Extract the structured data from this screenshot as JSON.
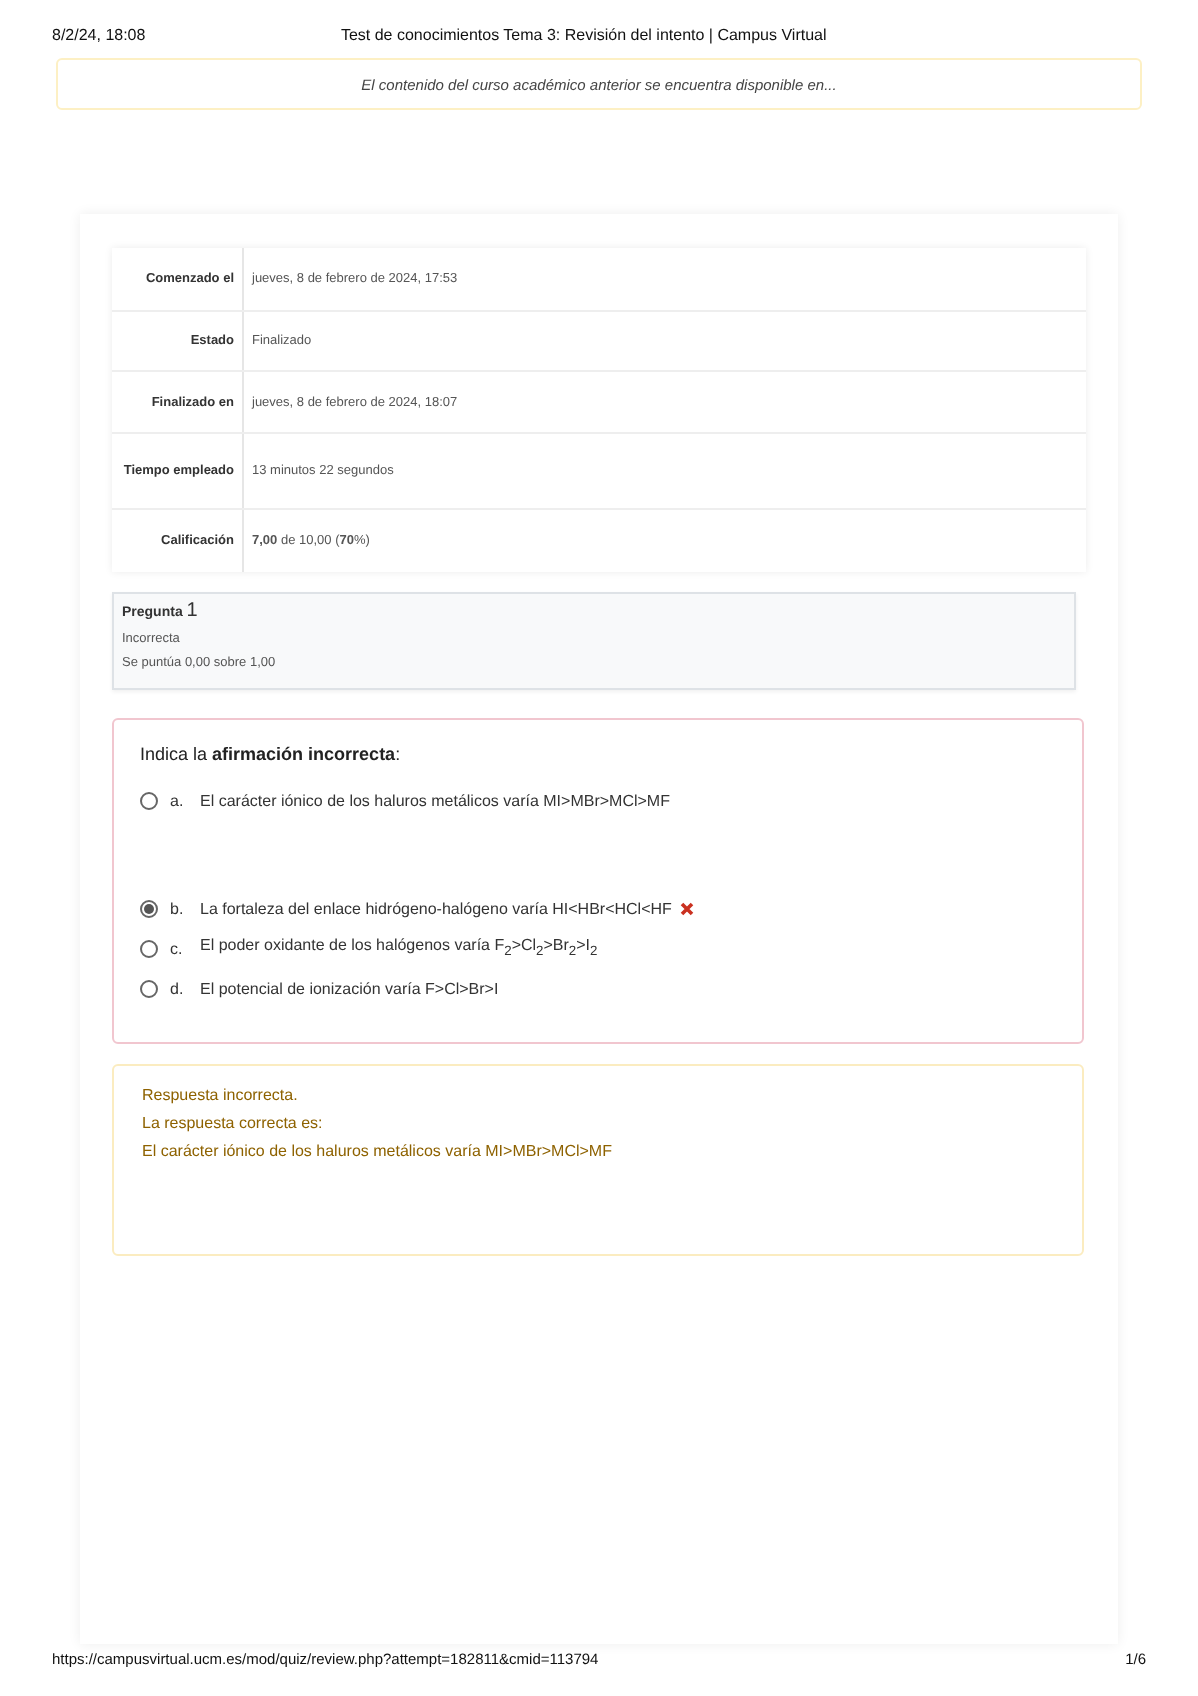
{
  "print_header": {
    "date": "8/2/24, 18:08",
    "title": "Test de conocimientos Tema 3: Revisión del intento | Campus Virtual"
  },
  "notice": "El contenido del curso académico anterior se encuentra disponible en...",
  "summary": [
    {
      "label": "Comenzado el",
      "value": "jueves, 8 de febrero de 2024, 17:53"
    },
    {
      "label": "Estado",
      "value": "Finalizado"
    },
    {
      "label": "Finalizado en",
      "value": "jueves, 8 de febrero de 2024, 18:07"
    },
    {
      "label": "Tiempo empleado",
      "value": "13 minutos 22 segundos"
    },
    {
      "label": "Calificación",
      "value": "**7,00** de 10,00 (**70**%)"
    }
  ],
  "question_info": {
    "title": "Pregunta",
    "number": "1",
    "status": "Incorrecta",
    "score": "Se puntúa 0,00 sobre 1,00"
  },
  "question": {
    "prompt": "Indica la **afirmación incorrecta**:",
    "options": [
      {
        "letter": "a.",
        "text": "El carácter iónico de los haluros metálicos varía MI>MBr>MCl>MF",
        "selected": false,
        "wrong": false
      },
      {
        "letter": "b.",
        "text": "La fortaleza del enlace hidrógeno-halógeno varía HI<HBr<HCl<HF",
        "selected": true,
        "wrong": true
      },
      {
        "letter": "c.",
        "text": "El poder oxidante de los halógenos varía F$_{2}$>Cl$_{2}$>Br$_{2}$>I$_{2}$",
        "selected": false,
        "wrong": false
      },
      {
        "letter": "d.",
        "text": "El potencial de ionización varía F>Cl>Br>I",
        "selected": false,
        "wrong": false
      }
    ]
  },
  "feedback": {
    "verdict": "Respuesta incorrecta.",
    "intro": "La respuesta correcta es:",
    "answer": "El carácter iónico de los haluros metálicos varía MI>MBr>MCl>MF"
  },
  "print_footer": {
    "url": "https://campusvirtual.ucm.es/mod/quiz/review.php?attempt=182811&cmid=113794",
    "page": "1/6"
  }
}
